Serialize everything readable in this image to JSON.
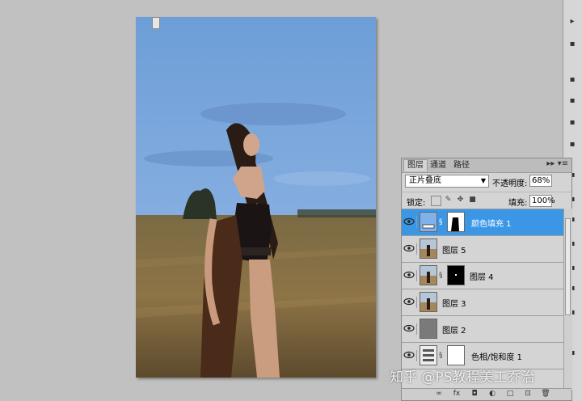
{
  "layers_panel": {
    "tabs": [
      {
        "label": "图层",
        "active": true
      },
      {
        "label": "通道",
        "active": false
      },
      {
        "label": "路径",
        "active": false
      }
    ],
    "blend_mode": "正片叠底",
    "opacity_label": "不透明度:",
    "opacity_value": "68%",
    "lock_label": "锁定:",
    "fill_label": "填充:",
    "fill_value": "100%",
    "layers": [
      {
        "name": "颜色填充 1",
        "thumbnail": "color-fill",
        "has_mask": true,
        "selected": true
      },
      {
        "name": "图层 5",
        "thumbnail": "photo",
        "has_mask": false,
        "selected": false
      },
      {
        "name": "图层 4",
        "thumbnail": "photo",
        "has_mask": true,
        "selected": false
      },
      {
        "name": "图层 3",
        "thumbnail": "photo",
        "has_mask": false,
        "selected": false
      },
      {
        "name": "图层 2",
        "thumbnail": "gray",
        "has_mask": false,
        "selected": false
      },
      {
        "name": "色相/饱和度 1",
        "thumbnail": "adjustment",
        "has_mask": true,
        "selected": false
      }
    ]
  },
  "watermark": "知乎 @PS教程美工乔治",
  "colors": {
    "workspace_bg": "#c1c1c1",
    "panel_bg": "#d4d4d4",
    "selection": "#3b97e6",
    "sky": "#6e9fd6",
    "fill_swatch": "#7fb2ea"
  }
}
